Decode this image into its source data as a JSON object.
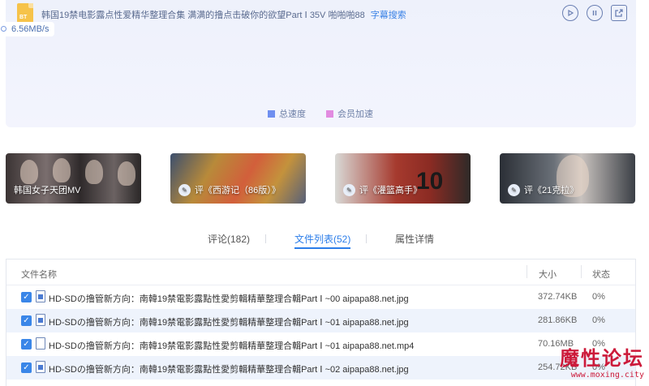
{
  "task": {
    "file_badge": "BT",
    "title": "韩国19禁电影露点性爱精华整理合集 满满的撸点击破你的欲望Part Ⅰ 35V 啪啪啪88",
    "subtitle_link": "字幕搜索",
    "speed": "6.56MB/s",
    "controls": [
      "play-icon",
      "pause-icon",
      "open-icon"
    ]
  },
  "legend": [
    {
      "label": "总速度",
      "color": "#6f8ff0"
    },
    {
      "label": "会员加速",
      "color": "#e28be0"
    }
  ],
  "cards": [
    {
      "label": "韩国女子天团MV",
      "badge": ""
    },
    {
      "label": "评《西游记（86版）》",
      "badge": "评"
    },
    {
      "label": "评《灌篮高手》",
      "badge": "评"
    },
    {
      "label": "评《21克拉》",
      "badge": "评"
    }
  ],
  "tabs": [
    {
      "label": "评论(182)"
    },
    {
      "label": "文件列表(52)"
    },
    {
      "label": "属性详情"
    }
  ],
  "table": {
    "headers": {
      "name": "文件名称",
      "size": "大小",
      "status": "状态"
    },
    "rows": [
      {
        "name": "HD-SDの撸管新方向：南韓19禁電影露點性愛剪輯精華整理合輯Part Ⅰ ~00 aipapa88.net.jpg",
        "size": "372.74KB",
        "status": "0%",
        "type": "image"
      },
      {
        "name": "HD-SDの撸管新方向：南韓19禁電影露點性愛剪輯精華整理合輯Part Ⅰ ~01 aipapa88.net.jpg",
        "size": "281.86KB",
        "status": "0%",
        "type": "image"
      },
      {
        "name": "HD-SDの撸管新方向：南韓19禁電影露點性愛剪輯精華整理合輯Part Ⅰ ~01 aipapa88.net.mp4",
        "size": "70.16MB",
        "status": "0%",
        "type": "video"
      },
      {
        "name": "HD-SDの撸管新方向：南韓19禁電影露點性愛剪輯精華整理合輯Part Ⅰ ~02 aipapa88.net.jpg",
        "size": "254.72KB",
        "status": "0%",
        "type": "image"
      }
    ]
  },
  "watermark": {
    "title": "魔性论坛",
    "url": "www.moxing.city"
  }
}
